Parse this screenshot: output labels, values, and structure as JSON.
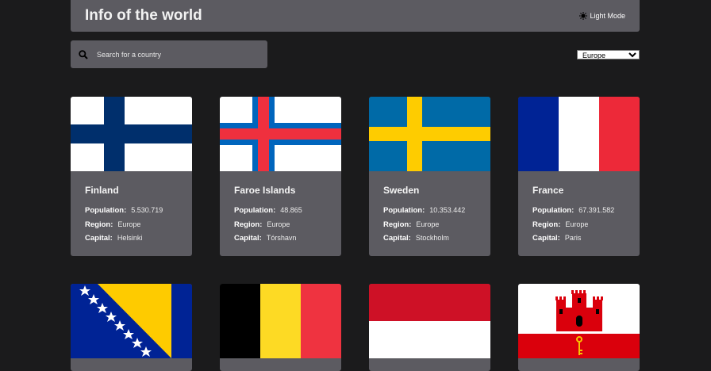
{
  "header": {
    "title": "Info of the world",
    "mode_label": "Light Mode"
  },
  "search": {
    "placeholder": "Search for a country"
  },
  "filter": {
    "selected": "Europe"
  },
  "labels": {
    "population": "Population:",
    "region": "Region:",
    "capital": "Capital:"
  },
  "countries": [
    {
      "name": "Finland",
      "population": "5.530.719",
      "region": "Europe",
      "capital": "Helsinki"
    },
    {
      "name": "Faroe Islands",
      "population": "48.865",
      "region": "Europe",
      "capital": "Tórshavn"
    },
    {
      "name": "Sweden",
      "population": "10.353.442",
      "region": "Europe",
      "capital": "Stockholm"
    },
    {
      "name": "France",
      "population": "67.391.582",
      "region": "Europe",
      "capital": "Paris"
    }
  ],
  "colors": {
    "background": "#1b1b1c",
    "surface": "#5c5b61",
    "finland_blue": "#002f6c",
    "faroe_blue": "#0065bd",
    "faroe_red": "#ef303e",
    "sweden_blue": "#006aa7",
    "sweden_yellow": "#fecc00",
    "france_blue": "#002395",
    "france_red": "#ed2939"
  }
}
